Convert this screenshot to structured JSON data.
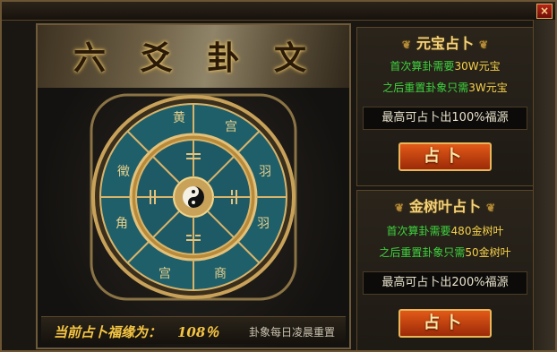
{
  "window": {
    "close_label": "×"
  },
  "left_panel": {
    "title_chars": [
      "六",
      "爻",
      "卦",
      "文"
    ],
    "wheel": {
      "outer_chars": [
        "黄",
        "宫",
        "羽",
        "羽",
        "商",
        "宫",
        "角",
        "徵"
      ],
      "inner_center_icon": "taiji-icon"
    },
    "luck_label": "当前占卜福缘为：",
    "luck_value": "108％",
    "reset_note": "卦象每日凌晨重置"
  },
  "yuanbao_panel": {
    "title": "元宝占卜",
    "line1_prefix": "首次算卦需要",
    "line1_highlight": "30W元宝",
    "line2_prefix": "之后重置卦象只需",
    "line2_highlight": "3W元宝",
    "max_text": "最高可占卜出100%福源",
    "button_label": "占卜"
  },
  "jinshuye_panel": {
    "title": "金树叶占卜",
    "line1_prefix": "首次算卦需要",
    "line1_highlight": "480金树叶",
    "line2_prefix": "之后重置卦象只需",
    "line2_highlight": "50金树叶",
    "max_text": "最高可占卜出200%福源",
    "button_label": "占卜"
  },
  "colors": {
    "accent_gold": "#f3d27a",
    "green_text": "#3ed23e",
    "highlight_yellow": "#f5d04a",
    "button_orange": "#e25a18"
  }
}
